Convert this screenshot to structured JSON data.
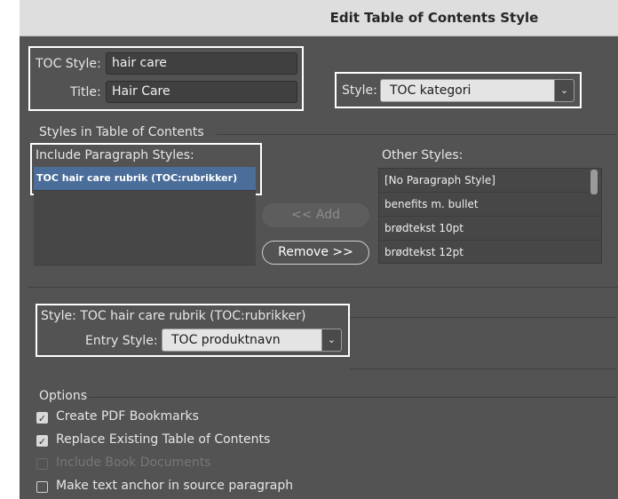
{
  "window": {
    "title": "Edit Table of Contents Style"
  },
  "toc": {
    "style_label": "TOC Style:",
    "style_value": "hair care",
    "title_label": "Title:",
    "title_value": "Hair Care",
    "title_style_label": "Style:",
    "title_style_value": "TOC kategori"
  },
  "styles_section": {
    "heading": "Styles in Table of Contents",
    "include_label": "Include Paragraph Styles:",
    "include_items": [
      "TOC hair care rubrik (TOC:rubrikker)"
    ],
    "other_label": "Other Styles:",
    "other_items": [
      "[No Paragraph Style]",
      "benefits m. bullet",
      "brødtekst 10pt",
      "brødtekst 12pt"
    ],
    "add_button": "<< Add",
    "remove_button": "Remove >>"
  },
  "style_section": {
    "heading": "Style: TOC hair care rubrik (TOC:rubrikker)",
    "entry_label": "Entry Style:",
    "entry_value": "TOC produktnavn"
  },
  "options": {
    "heading": "Options",
    "items": [
      {
        "label": "Create PDF Bookmarks",
        "state": "checked"
      },
      {
        "label": "Replace Existing Table of Contents",
        "state": "checked"
      },
      {
        "label": "Include Book Documents",
        "state": "disabled"
      },
      {
        "label": "Make text anchor in source paragraph",
        "state": "unchecked"
      }
    ]
  },
  "icons": {
    "dropdown": "chevron-down-icon",
    "checkbox": "checkmark-icon"
  }
}
